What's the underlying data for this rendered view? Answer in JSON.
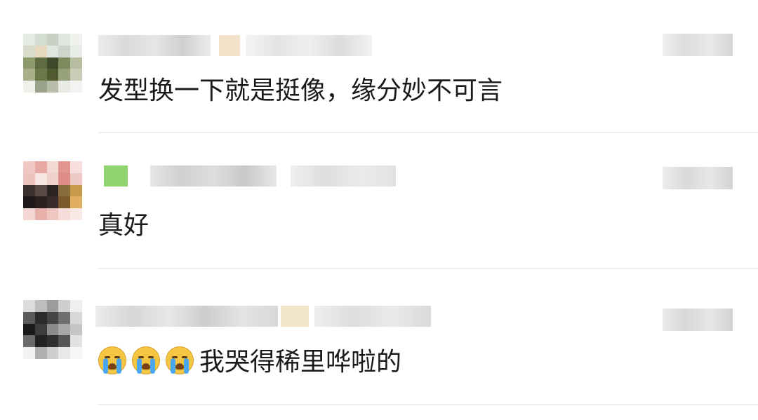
{
  "comments": [
    {
      "text": "发型换一下就是挺像，缘分妙不可言",
      "avatar_colors": [
        "#e6ece3",
        "#d4ddd2",
        "#c8d1c4",
        "#e0e6df",
        "#eef1ec",
        "#d7dccb",
        "#e7d9c0",
        "#dfe6e0",
        "#ced6cc",
        "#e9ede8",
        "#8d9a6a",
        "#5e6b43",
        "#3e4a2a",
        "#7f8a5f",
        "#b7be9f",
        "#a9b089",
        "#6d7848",
        "#50592f",
        "#98a27a",
        "#c9cdb8",
        "#eef0ea",
        "#9aa38a",
        "#b8bea9",
        "#e7ebe4",
        "#f3f4f1"
      ]
    },
    {
      "text": "真好",
      "avatar_colors": [
        "#f2c7c4",
        "#e8a9a4",
        "#f4d8d3",
        "#e2948f",
        "#f6dfdc",
        "#eec2bd",
        "#f8e6e3",
        "#f1cfca",
        "#dd8c86",
        "#efc9c4",
        "#3b3030",
        "#5a4944",
        "#2c2222",
        "#8a6d3a",
        "#c69a4a",
        "#1f1a1a",
        "#2a2020",
        "#3a2c2a",
        "#7a5a2a",
        "#e0b060",
        "#f4d6d2",
        "#e8b0aa",
        "#f0c6c0",
        "#f6ddd9",
        "#f9e9e6"
      ]
    },
    {
      "emoji_count": 3,
      "text": "我哭得稀里哗啦的",
      "avatar_colors": [
        "#dcdcdc",
        "#bdbdbd",
        "#9c9c9c",
        "#cfcfcf",
        "#efefef",
        "#5a5a5a",
        "#2a2a2a",
        "#454545",
        "#707070",
        "#d8d8d8",
        "#1a1a1a",
        "#3d3d3d",
        "#8a8a8a",
        "#a8a8a8",
        "#c4c4c4",
        "#6a6a6a",
        "#222222",
        "#2f2f2f",
        "#555555",
        "#e2e2e2",
        "#f2f2f2",
        "#b0b0b0",
        "#cfcfcf",
        "#e8e8e8",
        "#f7f7f7"
      ]
    }
  ]
}
